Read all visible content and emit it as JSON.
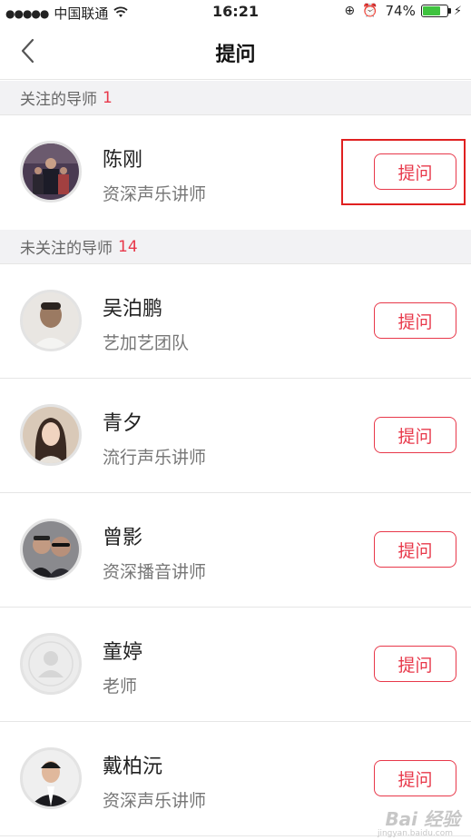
{
  "status_bar": {
    "signal_dots": "●●●●●",
    "carrier": "中国联通",
    "wifi_icon": "wifi-icon",
    "time": "16:21",
    "battery_percent": "74%",
    "battery_level": 0.74,
    "battery_color": "#3fc33f"
  },
  "nav": {
    "title": "提问"
  },
  "followed_section": {
    "label": "关注的导师",
    "count": "1"
  },
  "unfollowed_section": {
    "label": "未关注的导师",
    "count": "14"
  },
  "followed_mentors": [
    {
      "name": "陈刚",
      "title": "资深声乐讲师",
      "button": "提问",
      "avatar": "photo-group"
    }
  ],
  "unfollowed_mentors": [
    {
      "name": "吴泊鹏",
      "title": "艺加艺团队",
      "button": "提问",
      "avatar": "photo-man"
    },
    {
      "name": "青夕",
      "title": "流行声乐讲师",
      "button": "提问",
      "avatar": "photo-woman"
    },
    {
      "name": "曾影",
      "title": "资深播音讲师",
      "button": "提问",
      "avatar": "photo-two-men"
    },
    {
      "name": "童婷",
      "title": "老师",
      "button": "提问",
      "avatar": "default-user-icon"
    },
    {
      "name": "戴柏沅",
      "title": "资深声乐讲师",
      "button": "提问",
      "avatar": "photo-man-suit"
    }
  ],
  "watermark": {
    "text": "Bai 经验",
    "sub": "jingyan.baidu.com"
  },
  "colors": {
    "accent": "#e8384a",
    "section_bg": "#f2f2f4",
    "highlight": "#e02020"
  }
}
